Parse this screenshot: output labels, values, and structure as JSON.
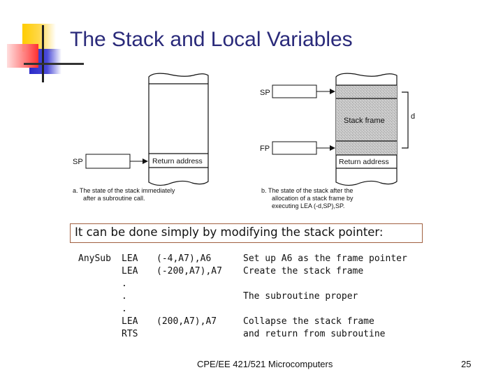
{
  "slide": {
    "title": "The Stack and Local Variables",
    "footer": "CPE/EE 421/521 Microcomputers",
    "page_number": "25"
  },
  "figure": {
    "panel_a": {
      "register_label": "SP",
      "cell_label": "Return address",
      "caption_line1": "a.  The state of the stack immediately",
      "caption_line2": "after a subroutine call."
    },
    "panel_b": {
      "sp_label": "SP",
      "fp_label": "FP",
      "frame_label": "Stack frame",
      "cell_label": "Return address",
      "size_label": "d",
      "caption_line1": "b.  The state of the stack after the",
      "caption_line2": "allocation of a stack frame by",
      "caption_line3": "executing LEA (-d,SP),SP."
    }
  },
  "callout": {
    "text": "It can be done simply by modifying the stack pointer:"
  },
  "code": [
    {
      "label": "AnySub",
      "op": "LEA",
      "arg": "(-4,A7),A6",
      "comment": "Set up A6 as the frame pointer"
    },
    {
      "label": "",
      "op": "LEA",
      "arg": "(-200,A7),A7",
      "comment": "Create the stack frame"
    },
    {
      "label": "",
      "op": ".",
      "arg": "",
      "comment": ""
    },
    {
      "label": "",
      "op": ".",
      "arg": "",
      "comment": "The subroutine proper"
    },
    {
      "label": "",
      "op": ".",
      "arg": "",
      "comment": ""
    },
    {
      "label": "",
      "op": "LEA",
      "arg": "(200,A7),A7",
      "comment": "Collapse the stack frame"
    },
    {
      "label": "",
      "op": "RTS",
      "arg": "",
      "comment": "and return from subroutine"
    }
  ]
}
